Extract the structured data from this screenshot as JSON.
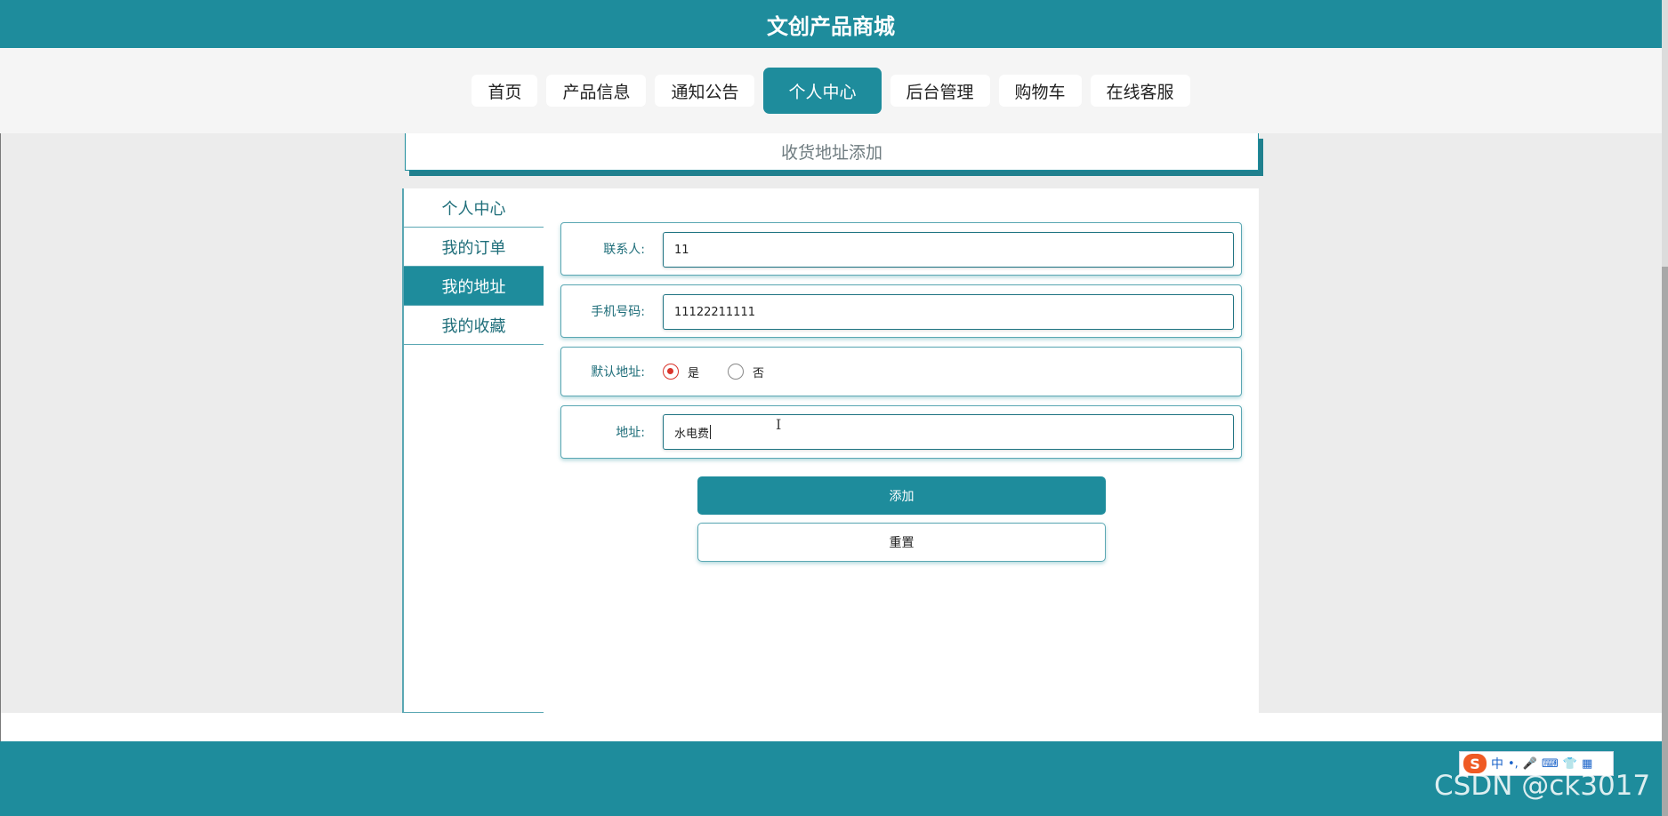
{
  "site": {
    "title": "文创产品商城"
  },
  "nav": [
    {
      "label": "首页",
      "active": false
    },
    {
      "label": "产品信息",
      "active": false
    },
    {
      "label": "通知公告",
      "active": false
    },
    {
      "label": "个人中心",
      "active": true
    },
    {
      "label": "后台管理",
      "active": false
    },
    {
      "label": "购物车",
      "active": false
    },
    {
      "label": "在线客服",
      "active": false
    }
  ],
  "page_heading": "收货地址添加",
  "side_menu": [
    {
      "label": "个人中心",
      "active": false
    },
    {
      "label": "我的订单",
      "active": false
    },
    {
      "label": "我的地址",
      "active": true
    },
    {
      "label": "我的收藏",
      "active": false
    }
  ],
  "form": {
    "contact": {
      "label": "联系人:",
      "value": "11"
    },
    "phone": {
      "label": "手机号码:",
      "value": "11122211111"
    },
    "default_address": {
      "label": "默认地址:",
      "options": [
        {
          "label": "是",
          "checked": true
        },
        {
          "label": "否",
          "checked": false
        }
      ]
    },
    "address": {
      "label": "地址:",
      "value": "水电费"
    }
  },
  "buttons": {
    "add": "添加",
    "reset": "重置"
  },
  "ime": {
    "logo": "S",
    "mode": "中",
    "punct": "•,",
    "mic": "🎤",
    "keyboard": "⌨",
    "skin": "👕",
    "apps": "▦"
  },
  "watermark": "CSDN @ck3017",
  "colors": {
    "primary": "#1e8c9c",
    "radio_checked": "#d9342b",
    "background": "#ececec"
  }
}
